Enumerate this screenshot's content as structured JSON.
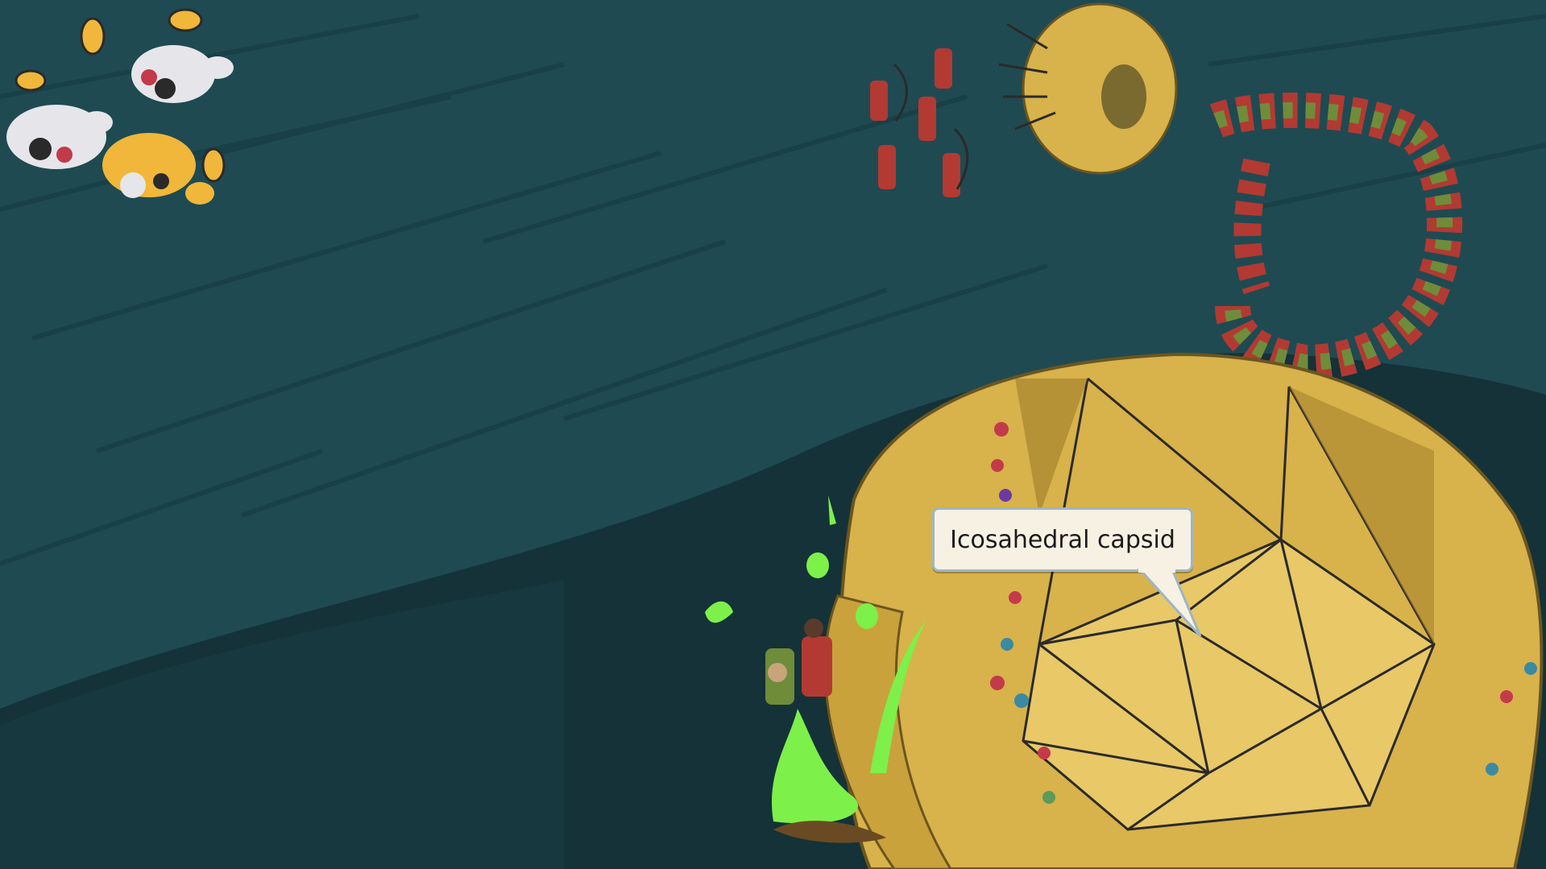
{
  "scene": {
    "description_tags": [
      "cartoon",
      "virus-illustration"
    ],
    "palette": {
      "background": "#1f4a52",
      "background_dark": "#173c43",
      "hill": "#143238",
      "capsid_gold": "#d8b24a",
      "capsid_shadow": "#a7842e",
      "capsid_light": "#e8c867",
      "red_uniform": "#b23a32",
      "green_uniform": "#6f8c3a",
      "slime_green": "#7df04a",
      "bee_yellow": "#f0b73a",
      "cow_white": "#e6e6ea"
    }
  },
  "callout": {
    "label": "Icosahedral capsid",
    "border_color": "#9fb6c2",
    "fill_color": "#f6f1e3"
  }
}
